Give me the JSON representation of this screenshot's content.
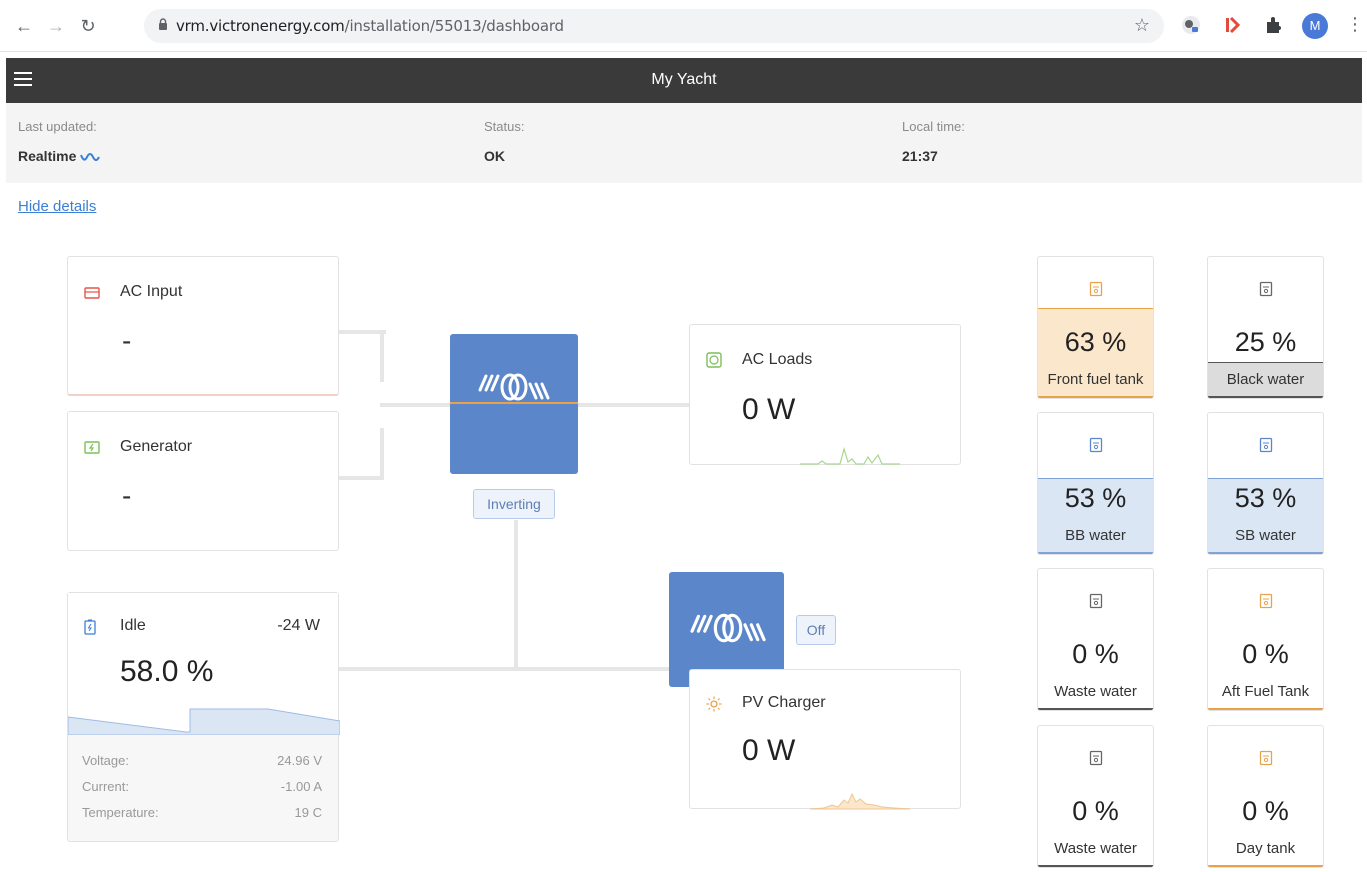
{
  "browser": {
    "url_host": "vrm.victronenergy.com",
    "url_path": "/installation/55013/dashboard",
    "avatar_letter": "M"
  },
  "header": {
    "title": "My Yacht"
  },
  "info": {
    "last_updated_label": "Last updated:",
    "last_updated_value": "Realtime",
    "status_label": "Status:",
    "status_value": "OK",
    "local_time_label": "Local time:",
    "local_time_value": "21:37"
  },
  "hide_details": "Hide details",
  "ac_input": {
    "title": "AC Input",
    "value": "-"
  },
  "generator": {
    "title": "Generator",
    "value": "-"
  },
  "inverter": {
    "status": "Inverting"
  },
  "ac_loads": {
    "title": "AC Loads",
    "value": "0 W"
  },
  "mppt": {
    "status": "Off"
  },
  "pv_charger": {
    "title": "PV Charger",
    "value": "0 W"
  },
  "battery": {
    "state": "Idle",
    "power": "-24 W",
    "soc": "58.0 %",
    "details": [
      {
        "label": "Voltage:",
        "value": "24.96 V"
      },
      {
        "label": "Current:",
        "value": "-1.00 A"
      },
      {
        "label": "Temperature:",
        "value": "19 C"
      }
    ]
  },
  "tanks": [
    {
      "name": "Front fuel tank",
      "value": "63 %",
      "level": 63,
      "fill": "#fbe7cc",
      "border": "#e8a24a",
      "icon": "#e8a24a"
    },
    {
      "name": "Black water",
      "value": "25 %",
      "level": 25,
      "fill": "#dcdcdc",
      "border": "#555555",
      "icon": "#666666"
    },
    {
      "name": "BB water",
      "value": "53 %",
      "level": 53,
      "fill": "#dbe6f5",
      "border": "#7fa3d6",
      "icon": "#5b86c9"
    },
    {
      "name": "SB water",
      "value": "53 %",
      "level": 53,
      "fill": "#dbe6f5",
      "border": "#7fa3d6",
      "icon": "#5b86c9"
    },
    {
      "name": "Waste water",
      "value": "0 %",
      "level": 0,
      "fill": "#eeeeee",
      "border": "#555555",
      "icon": "#666666"
    },
    {
      "name": "Aft Fuel Tank",
      "value": "0 %",
      "level": 0,
      "fill": "#fbe7cc",
      "border": "#e8a24a",
      "icon": "#e8a24a"
    },
    {
      "name": "Waste water",
      "value": "0 %",
      "level": 0,
      "fill": "#eeeeee",
      "border": "#555555",
      "icon": "#666666"
    },
    {
      "name": "Day tank",
      "value": "0 %",
      "level": 0,
      "fill": "#fbe7cc",
      "border": "#e8a24a",
      "icon": "#e8a24a"
    }
  ]
}
